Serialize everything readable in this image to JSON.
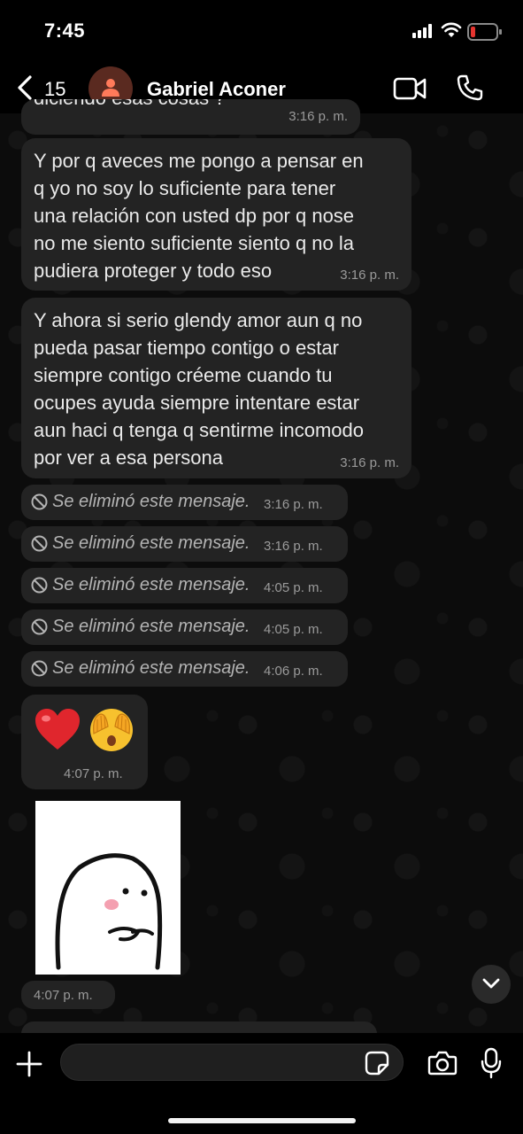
{
  "status_bar": {
    "time": "7:45"
  },
  "header": {
    "back_count": "15",
    "contact_name": "Gabriel Aconer"
  },
  "messages": {
    "partial": {
      "text": "diciendo esas cosas ?",
      "time": "3:16 p. m."
    },
    "m1": {
      "lines": [
        "Y por q aveces me pongo a pensar en",
        "q yo no soy lo suficiente para tener",
        "una relación con usted dp por q nose",
        "no me siento suficiente siento q no la",
        "pudiera proteger y todo eso"
      ],
      "time": "3:16 p. m."
    },
    "m2": {
      "lines": [
        "Y ahora si serio glendy amor aun q no",
        "pueda pasar tiempo contigo o estar",
        "siempre contigo créeme cuando tu",
        "ocupes ayuda siempre intentare estar",
        "aun haci q tenga q sentirme incomodo",
        "por ver a esa persona"
      ],
      "time": "3:16 p. m."
    },
    "deleted": [
      {
        "text": "Se eliminó este mensaje.",
        "time": "3:16 p. m."
      },
      {
        "text": "Se eliminó este mensaje.",
        "time": "3:16 p. m."
      },
      {
        "text": "Se eliminó este mensaje.",
        "time": "4:05 p. m."
      },
      {
        "text": "Se eliminó este mensaje.",
        "time": "4:05 p. m."
      },
      {
        "text": "Se eliminó este mensaje.",
        "time": "4:06 p. m."
      }
    ],
    "emoji": {
      "emojis": [
        "red-heart",
        "face-with-hand-over-eyes"
      ],
      "time": "4:07 p. m."
    },
    "sticker": {
      "time": "4:07 p. m."
    }
  },
  "icons": {
    "back": "chevron-left-icon",
    "video": "video-camera-icon",
    "phone": "phone-icon",
    "plus": "plus-icon",
    "sticker": "sticker-icon",
    "camera": "camera-icon",
    "mic": "microphone-icon",
    "scroll_down": "chevron-down-icon"
  },
  "colors": {
    "bubble": "#232323",
    "background": "#0b0b0b",
    "battery_low": "#e5342f"
  }
}
